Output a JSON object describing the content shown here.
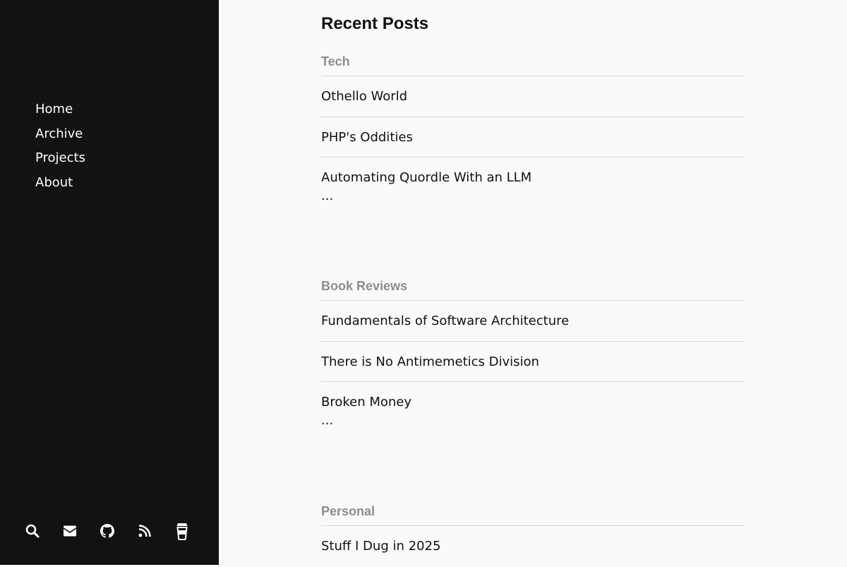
{
  "sidebar": {
    "nav": [
      "Home",
      "Archive",
      "Projects",
      "About"
    ],
    "icons": [
      "search-icon",
      "mail-icon",
      "github-icon",
      "rss-icon",
      "coffee-cup-icon"
    ]
  },
  "main": {
    "title": "Recent Posts",
    "sections": [
      {
        "title": "Tech",
        "posts": [
          "Othello World",
          "PHP's Oddities",
          "Automating Quordle With an LLM"
        ],
        "more": "..."
      },
      {
        "title": "Book Reviews",
        "posts": [
          "Fundamentals of Software Architecture",
          "There is No Antimemetics Division",
          "Broken Money"
        ],
        "more": "..."
      },
      {
        "title": "Personal",
        "posts": [
          "Stuff I Dug in 2025"
        ]
      }
    ]
  },
  "colors": {
    "sidebar_bg": "#121212",
    "page_bg": "#fafafa",
    "section_title": "#8c8c8c",
    "divider": "#d7d7d7"
  }
}
